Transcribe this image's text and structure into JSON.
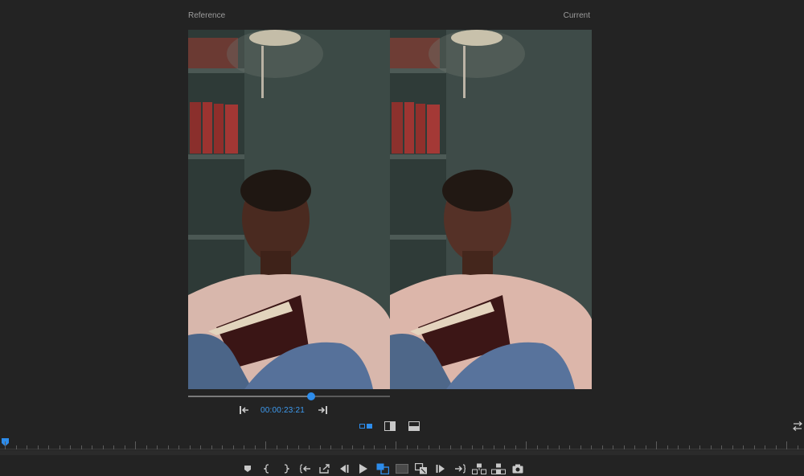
{
  "monitor": {
    "reference_label": "Reference",
    "current_label": "Current"
  },
  "reference_controls": {
    "timecode": "00:00:23:21",
    "scrub_position": 0.61
  },
  "view_modes": [
    "side-by-side-icon",
    "vertical-split-icon",
    "horizontal-split-icon"
  ],
  "transport_icons": [
    "add-marker-icon",
    "mark-in-icon",
    "mark-out-icon",
    "go-to-in-icon",
    "lift-export-icon",
    "step-back-icon",
    "play-icon",
    "comparison-view-icon",
    "safe-margins-icon",
    "lumetri-compare-icon",
    "step-forward-icon",
    "go-to-out-icon",
    "insert-icon",
    "overwrite-icon",
    "export-frame-icon"
  ],
  "colors": {
    "accent": "#2d8ceb",
    "timecode": "#3e9bf0",
    "background": "#232323"
  }
}
